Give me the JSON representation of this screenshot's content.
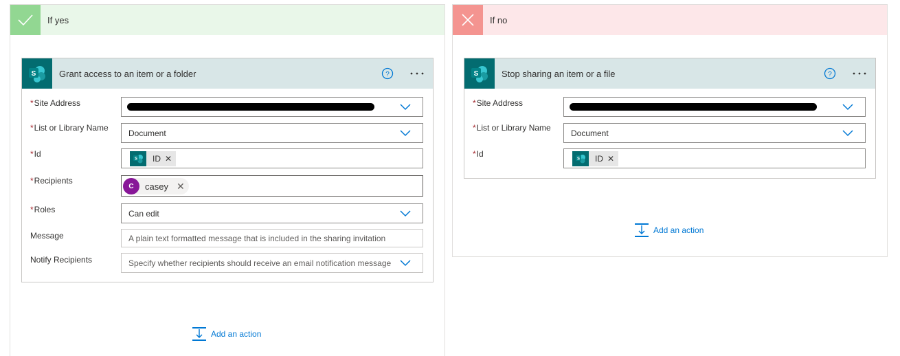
{
  "branches": {
    "yes": {
      "title": "If yes",
      "card": {
        "title": "Grant access to an item or a folder",
        "fields": [
          {
            "label": "Site Address",
            "required": "*",
            "value": ""
          },
          {
            "label": "List or Library Name",
            "required": "*",
            "value": "Document"
          },
          {
            "label": "Id",
            "required": "*",
            "token": "ID"
          },
          {
            "label": "Recipients",
            "required": "*",
            "person_initial": "C",
            "person_name": "casey"
          },
          {
            "label": "Roles",
            "required": "*",
            "value": "Can edit"
          },
          {
            "label": "Message",
            "placeholder": "A plain text formatted message that is included in the sharing invitation"
          },
          {
            "label": "Notify Recipients",
            "placeholder": "Specify whether recipients should receive an email notification message"
          }
        ]
      },
      "add_action": "Add an action"
    },
    "no": {
      "title": "If no",
      "card": {
        "title": "Stop sharing an item or a file",
        "fields": [
          {
            "label": "Site Address",
            "required": "*",
            "value": ""
          },
          {
            "label": "List or Library Name",
            "required": "*",
            "value": "Document"
          },
          {
            "label": "Id",
            "required": "*",
            "token": "ID"
          }
        ]
      },
      "add_action": "Add an action"
    }
  },
  "icons": {
    "yes_branch": "checkmark-icon",
    "no_branch": "close-icon",
    "connector": "sharepoint-icon",
    "help": "help-icon",
    "more": "more-options-icon",
    "dropdown": "chevron-down-icon",
    "add_action": "add-action-icon"
  },
  "colors": {
    "yes_header": "#e9f7e9",
    "yes_icon": "#92d792",
    "no_header": "#fde7e9",
    "no_icon": "#f49490",
    "card_header": "#d8e6e7",
    "sharepoint": "#036c70",
    "link": "#0078d4",
    "required": "#a4262c",
    "avatar": "#881798"
  }
}
